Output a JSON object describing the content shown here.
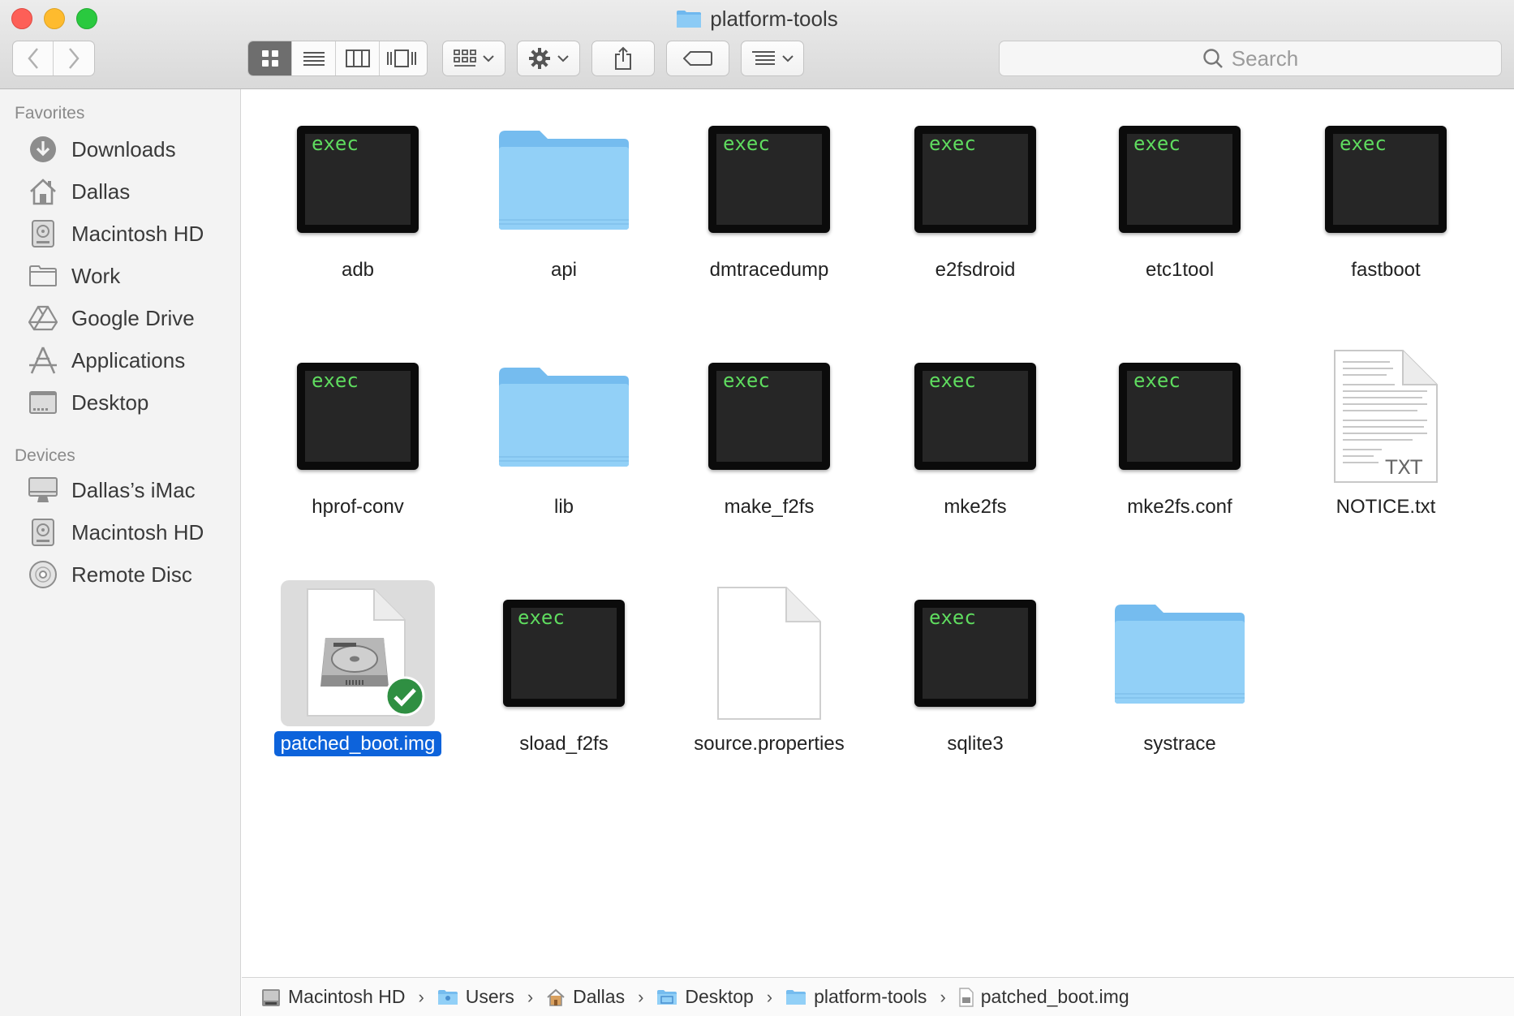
{
  "window": {
    "title": "platform-tools"
  },
  "toolbar": {
    "search_placeholder": "Search"
  },
  "sidebar": {
    "favorites_header": "Favorites",
    "favorites": [
      {
        "label": "Downloads",
        "icon": "downloads-icon"
      },
      {
        "label": "Dallas",
        "icon": "home-icon"
      },
      {
        "label": "Macintosh HD",
        "icon": "hard-drive-icon"
      },
      {
        "label": "Work",
        "icon": "folder-icon"
      },
      {
        "label": "Google Drive",
        "icon": "google-drive-icon"
      },
      {
        "label": "Applications",
        "icon": "applications-icon"
      },
      {
        "label": "Desktop",
        "icon": "desktop-icon"
      }
    ],
    "devices_header": "Devices",
    "devices": [
      {
        "label": "Dallas’s iMac",
        "icon": "imac-icon"
      },
      {
        "label": "Macintosh HD",
        "icon": "hard-drive-icon"
      },
      {
        "label": "Remote Disc",
        "icon": "disc-icon"
      }
    ]
  },
  "files": [
    {
      "name": "adb",
      "kind": "exec",
      "exec_text": "exec"
    },
    {
      "name": "api",
      "kind": "folder"
    },
    {
      "name": "dmtracedump",
      "kind": "exec",
      "exec_text": "exec"
    },
    {
      "name": "e2fsdroid",
      "kind": "exec",
      "exec_text": "exec"
    },
    {
      "name": "etc1tool",
      "kind": "exec",
      "exec_text": "exec"
    },
    {
      "name": "fastboot",
      "kind": "exec",
      "exec_text": "exec"
    },
    {
      "name": "hprof-conv",
      "kind": "exec",
      "exec_text": "exec"
    },
    {
      "name": "lib",
      "kind": "folder"
    },
    {
      "name": "make_f2fs",
      "kind": "exec",
      "exec_text": "exec"
    },
    {
      "name": "mke2fs",
      "kind": "exec",
      "exec_text": "exec"
    },
    {
      "name": "mke2fs.conf",
      "kind": "exec",
      "exec_text": "exec"
    },
    {
      "name": "NOTICE.txt",
      "kind": "text",
      "doc_text": "TXT"
    },
    {
      "name": "patched_boot.img",
      "kind": "disk-image",
      "selected": true
    },
    {
      "name": "sload_f2fs",
      "kind": "exec",
      "exec_text": "exec"
    },
    {
      "name": "source.properties",
      "kind": "document"
    },
    {
      "name": "sqlite3",
      "kind": "exec",
      "exec_text": "exec"
    },
    {
      "name": "systrace",
      "kind": "folder"
    }
  ],
  "pathbar": [
    {
      "label": "Macintosh HD",
      "icon": "hard-drive-icon"
    },
    {
      "label": "Users",
      "icon": "folder-icon"
    },
    {
      "label": "Dallas",
      "icon": "home-icon"
    },
    {
      "label": "Desktop",
      "icon": "folder-icon"
    },
    {
      "label": "platform-tools",
      "icon": "folder-icon"
    },
    {
      "label": "patched_boot.img",
      "icon": "file-icon"
    }
  ],
  "colors": {
    "selection": "#0d63db",
    "folder": "#8ccbf5",
    "exec_text": "#5fdc5f"
  }
}
